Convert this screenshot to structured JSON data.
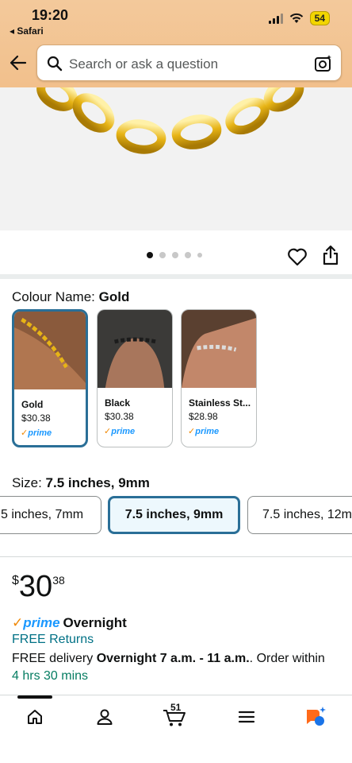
{
  "status_bar": {
    "time": "19:20",
    "back_app": "◂ Safari",
    "battery": "54"
  },
  "search": {
    "placeholder": "Search or ask a question",
    "back_icon": "back-arrow-icon",
    "camera_icon": "camera-scan-icon"
  },
  "carousel": {
    "image_count": 5,
    "active_index": 0
  },
  "colour": {
    "label": "Colour Name: ",
    "selected": "Gold",
    "options": [
      {
        "name": "Gold",
        "price": "$30.38",
        "badge": "prime",
        "selected": true
      },
      {
        "name": "Black",
        "price": "$30.38",
        "badge": "prime",
        "selected": false
      },
      {
        "name": "Stainless St...",
        "price": "$28.98",
        "badge": "prime",
        "selected": false
      }
    ]
  },
  "size": {
    "label": "Size: ",
    "selected": "7.5 inches, 9mm",
    "options": [
      {
        "label": "5 inches, 7mm",
        "selected": false
      },
      {
        "label": "7.5 inches, 9mm",
        "selected": true
      },
      {
        "label": "7.5 inches, 12m",
        "selected": false
      }
    ]
  },
  "price": {
    "symbol": "$",
    "whole": "30",
    "fraction": "38"
  },
  "delivery": {
    "prime_label": "prime",
    "overnight": "Overnight",
    "free_returns": "FREE Returns",
    "prefix": "FREE delivery ",
    "window": "Overnight 7 a.m. - 11 a.m.",
    "suffix": ". Order within",
    "countdown": "4 hrs 30 mins"
  },
  "bottom_nav": {
    "cart_count": "51",
    "items": [
      "home-icon",
      "account-icon",
      "cart-icon",
      "menu-icon",
      "rufus-assistant-icon"
    ]
  },
  "colors": {
    "header_bg": "#f3c99b",
    "selected_border": "#2a6f97",
    "link": "#007185",
    "prime_blue": "#1a98ff",
    "countdown_green": "#067d62"
  }
}
